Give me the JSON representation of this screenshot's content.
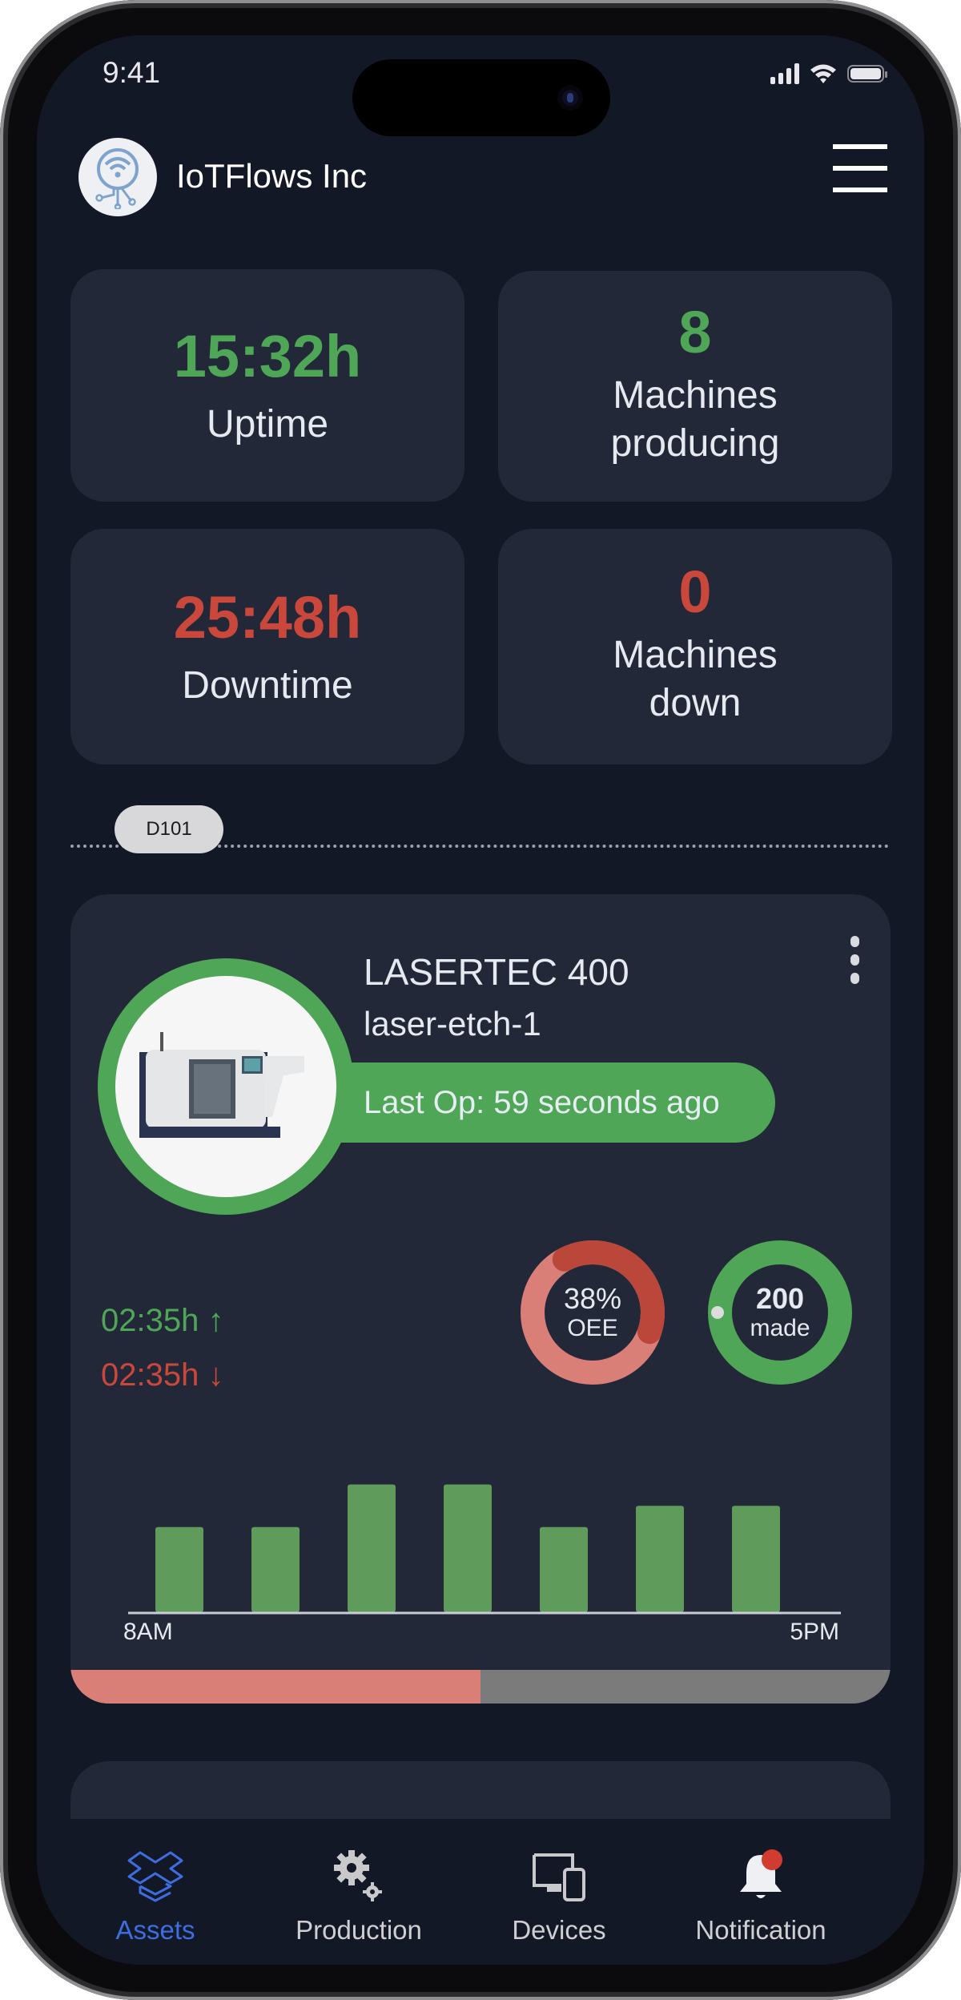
{
  "status_bar": {
    "time": "9:41"
  },
  "header": {
    "company_name": "IoTFlows Inc",
    "logo_icon": "iot-wifi-circuit-icon",
    "menu_icon": "hamburger-menu-icon"
  },
  "kpis": [
    {
      "value": "15:32h",
      "label": "Uptime",
      "color": "#4ea656"
    },
    {
      "value": "8",
      "label_line1": "Machines",
      "label_line2": "producing",
      "color": "#4ea656"
    },
    {
      "value": "25:48h",
      "label": "Downtime",
      "color": "#c9473b"
    },
    {
      "value": "0",
      "label_line1": "Machines",
      "label_line2": "down",
      "color": "#c9473b"
    }
  ],
  "group": {
    "label": "D101"
  },
  "machine": {
    "name": "LASERTEC 400",
    "id": "laser-etch-1",
    "last_op": "Last Op: 59 seconds ago",
    "status_color": "#4ea656",
    "uptime": "02:35h ↑",
    "downtime": "02:35h ↓",
    "oee": {
      "value_text": "38%",
      "label": "OEE",
      "percent": 38
    },
    "made": {
      "value_text": "200",
      "label": "made",
      "fraction": 1.0
    },
    "timeline_progress_percent": 50
  },
  "chart_data": {
    "type": "bar",
    "title": "",
    "xlabel": "",
    "ylabel": "",
    "categories": [
      "8AM",
      "",
      "",
      "",
      "",
      "",
      "5PM"
    ],
    "tick_labels": [
      "8AM",
      "5PM"
    ],
    "values": [
      2,
      2,
      3,
      3,
      2,
      2.5,
      2.5
    ],
    "ylim": [
      0,
      3.2
    ],
    "color": "#5f9c5c",
    "grid": false
  },
  "bottom_nav": [
    {
      "label": "Assets",
      "icon": "assets-box-icon",
      "active": true
    },
    {
      "label": "Production",
      "icon": "gears-icon",
      "active": false
    },
    {
      "label": "Devices",
      "icon": "devices-icon",
      "active": false
    },
    {
      "label": "Notification",
      "icon": "bell-icon",
      "active": false,
      "badge": true
    }
  ],
  "colors": {
    "background": "#131827",
    "card": "#222838",
    "accent": "#3d6de0",
    "green": "#4ea656",
    "red": "#c9473b"
  }
}
